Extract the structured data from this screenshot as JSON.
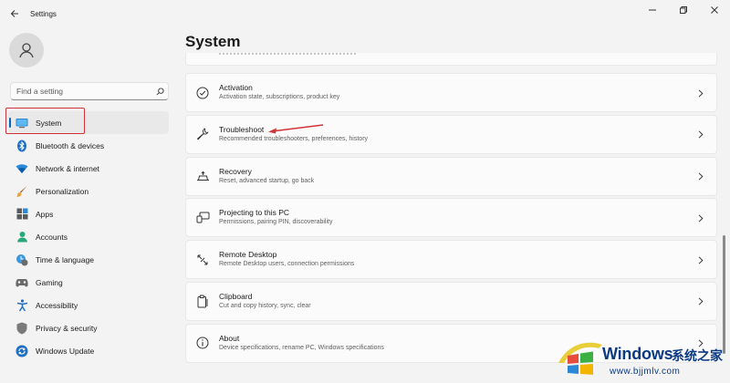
{
  "window": {
    "title": "Settings"
  },
  "search": {
    "placeholder": "Find a setting"
  },
  "sidebar": {
    "items": [
      {
        "label": "System",
        "icon": "system-icon",
        "selected": true
      },
      {
        "label": "Bluetooth & devices",
        "icon": "bluetooth-icon"
      },
      {
        "label": "Network & internet",
        "icon": "network-icon"
      },
      {
        "label": "Personalization",
        "icon": "brush-icon"
      },
      {
        "label": "Apps",
        "icon": "apps-icon"
      },
      {
        "label": "Accounts",
        "icon": "accounts-icon"
      },
      {
        "label": "Time & language",
        "icon": "time-language-icon"
      },
      {
        "label": "Gaming",
        "icon": "gaming-icon"
      },
      {
        "label": "Accessibility",
        "icon": "accessibility-icon"
      },
      {
        "label": "Privacy & security",
        "icon": "shield-icon"
      },
      {
        "label": "Windows Update",
        "icon": "update-icon"
      }
    ]
  },
  "main": {
    "title": "System",
    "rows": [
      {
        "title": "Activation",
        "desc": "Activation state, subscriptions, product key",
        "icon": "check-circle-icon"
      },
      {
        "title": "Troubleshoot",
        "desc": "Recommended troubleshooters, preferences, history",
        "icon": "wrench-icon"
      },
      {
        "title": "Recovery",
        "desc": "Reset, advanced startup, go back",
        "icon": "recovery-icon"
      },
      {
        "title": "Projecting to this PC",
        "desc": "Permissions, pairing PIN, discoverability",
        "icon": "projector-icon"
      },
      {
        "title": "Remote Desktop",
        "desc": "Remote Desktop users, connection permissions",
        "icon": "remote-desktop-icon"
      },
      {
        "title": "Clipboard",
        "desc": "Cut and copy history, sync, clear",
        "icon": "clipboard-icon"
      },
      {
        "title": "About",
        "desc": "Device specifications, rename PC, Windows specifications",
        "icon": "info-icon"
      }
    ]
  },
  "colors": {
    "accent": "#0067c0",
    "annotation": "#d13438",
    "watermark": "#0b3a82"
  },
  "watermark": {
    "brand": "Windows",
    "cn": "系统之家",
    "url": "www.bjjmlv.com"
  }
}
